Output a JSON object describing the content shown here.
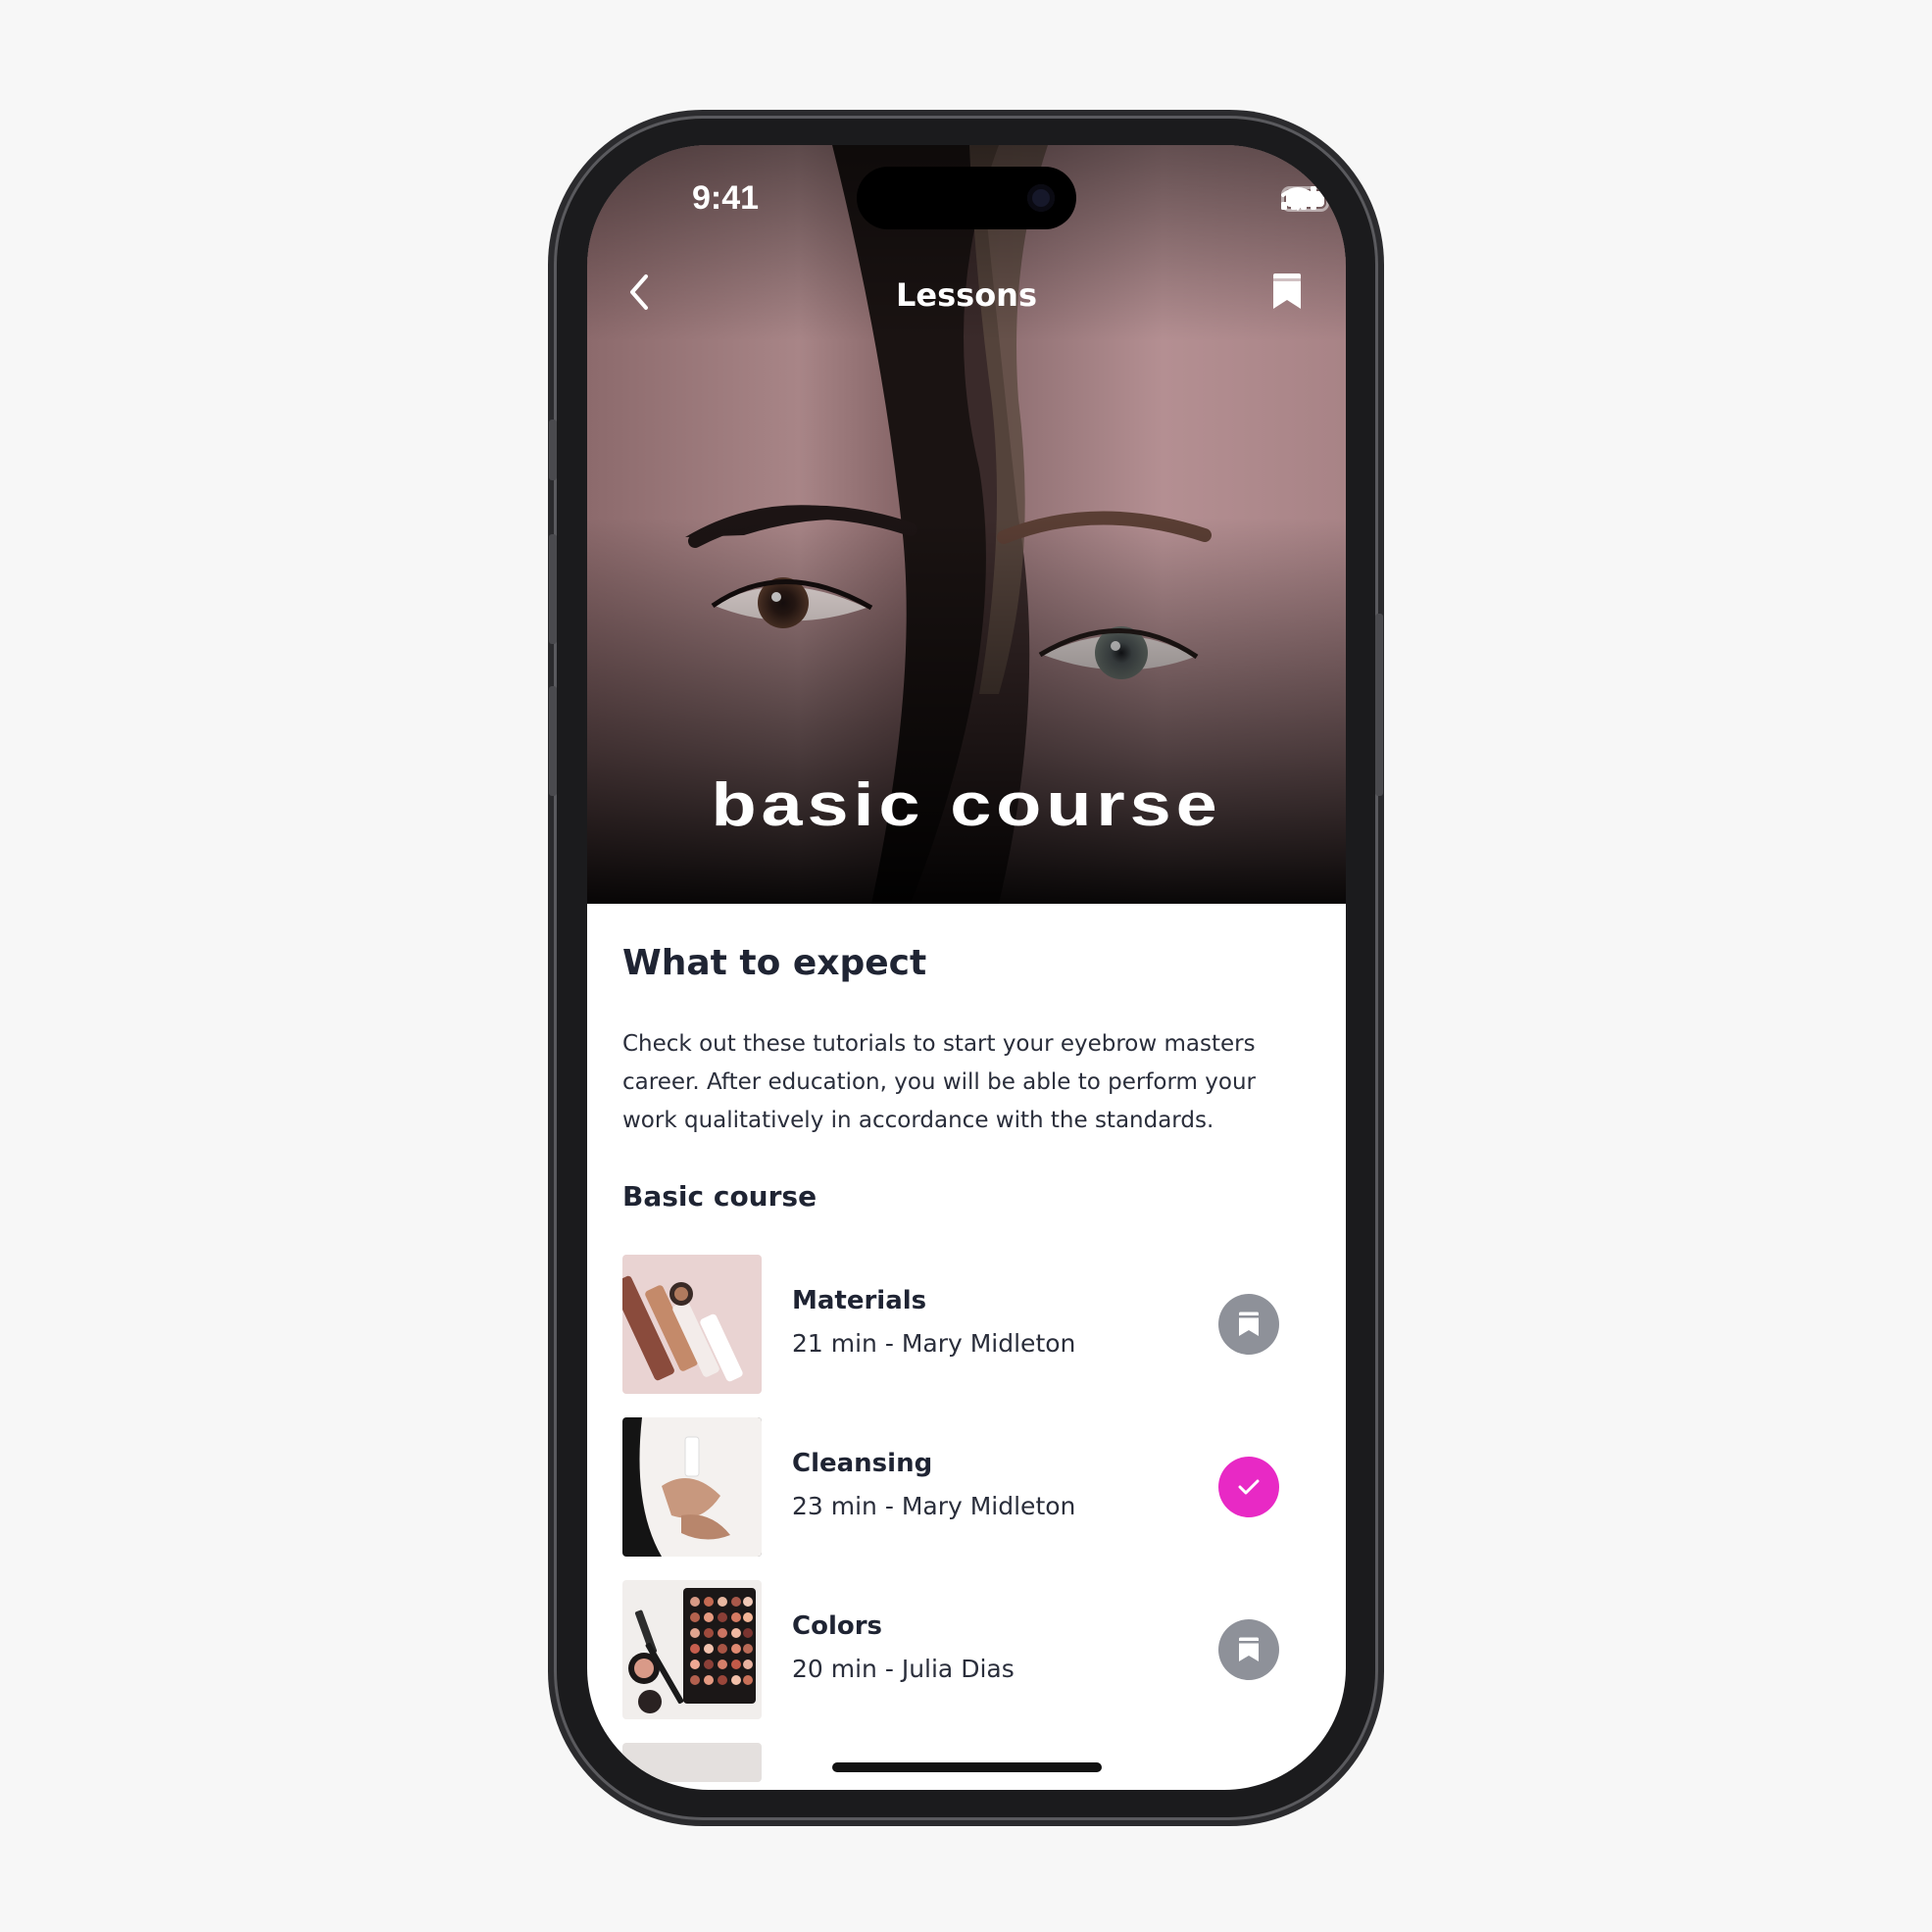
{
  "status_bar": {
    "time": "9:41",
    "icons": [
      "cellular-signal-icon",
      "wifi-icon",
      "battery-icon"
    ]
  },
  "nav": {
    "back_icon": "chevron-left-icon",
    "title": "Lessons",
    "bookmark_icon": "bookmark-icon"
  },
  "hero": {
    "title": "basic course"
  },
  "expect": {
    "heading": "What to expect",
    "description": "Check out these tutorials to start your eyebrow masters career. After education, you will be able to perform your work qualitatively in accordance with the standards."
  },
  "course": {
    "heading": "Basic course",
    "lessons": [
      {
        "title": "Materials",
        "meta": "21 min - Mary Midleton",
        "status": "saved",
        "action_icon": "bookmark-icon"
      },
      {
        "title": "Cleansing",
        "meta": "23 min - Mary Midleton",
        "status": "completed",
        "action_icon": "checkmark-icon"
      },
      {
        "title": "Colors",
        "meta": "20 min - Julia Dias",
        "status": "saved",
        "action_icon": "bookmark-icon"
      }
    ]
  },
  "colors": {
    "accent": "#e829c5",
    "saved_badge": "#8e9199",
    "heading_text": "#1f2433"
  }
}
